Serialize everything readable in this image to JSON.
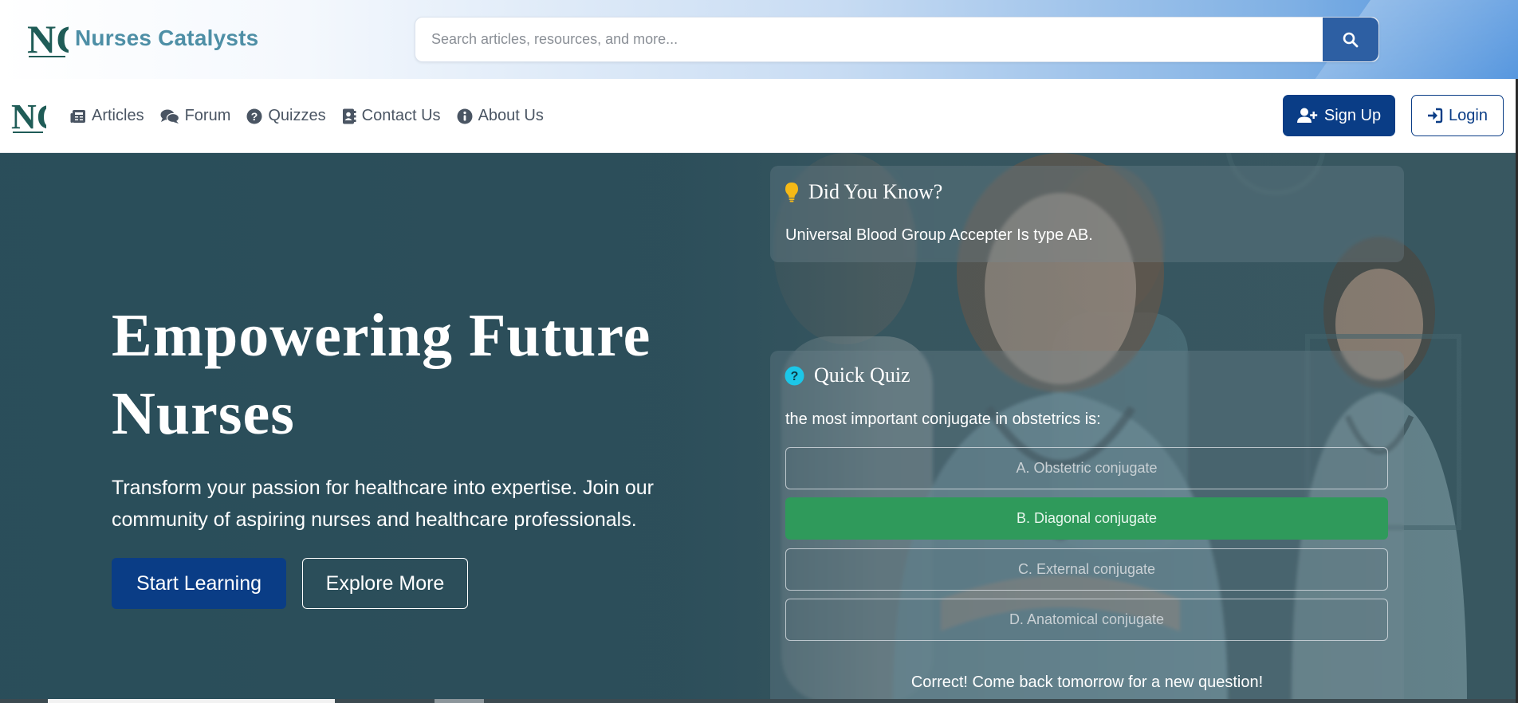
{
  "brand": {
    "name": "Nurses Catalysts",
    "logo_letters": "NC"
  },
  "search": {
    "placeholder": "Search articles, resources, and more...",
    "value": ""
  },
  "nav": {
    "items": [
      {
        "label": "Articles",
        "icon": "newspaper-icon"
      },
      {
        "label": "Forum",
        "icon": "comments-icon"
      },
      {
        "label": "Quizzes",
        "icon": "question-circle-icon"
      },
      {
        "label": "Contact Us",
        "icon": "address-book-icon"
      },
      {
        "label": "About Us",
        "icon": "info-circle-icon"
      }
    ],
    "signup_label": "Sign Up",
    "login_label": "Login"
  },
  "hero": {
    "title_line1": "Empowering Future",
    "title_line2": "Nurses",
    "subtitle": "Transform your passion for healthcare into expertise. Join our community of aspiring nurses and healthcare professionals.",
    "start_label": "Start Learning",
    "explore_label": "Explore More"
  },
  "did_you_know": {
    "title": "Did You Know?",
    "text": "Universal Blood Group Accepter Is type AB.",
    "icon": "lightbulb-icon"
  },
  "quiz": {
    "title": "Quick Quiz",
    "icon": "question-circle-icon",
    "question": "the most important conjugate in obstetrics is:",
    "options": [
      {
        "label": "A. Obstetric conjugate",
        "state": "default"
      },
      {
        "label": "B. Diagonal conjugate",
        "state": "correct"
      },
      {
        "label": "C. External conjugate",
        "state": "default"
      },
      {
        "label": "D. Anatomical conjugate",
        "state": "default"
      }
    ],
    "result": "Correct! Come back tomorrow for a new question!"
  },
  "colors": {
    "primary": "#0a3d86",
    "brand_teal": "#4e8fa6",
    "correct": "#2f9a5b",
    "bulb": "#f5b916",
    "quiz_icon": "#1cc7e8"
  }
}
